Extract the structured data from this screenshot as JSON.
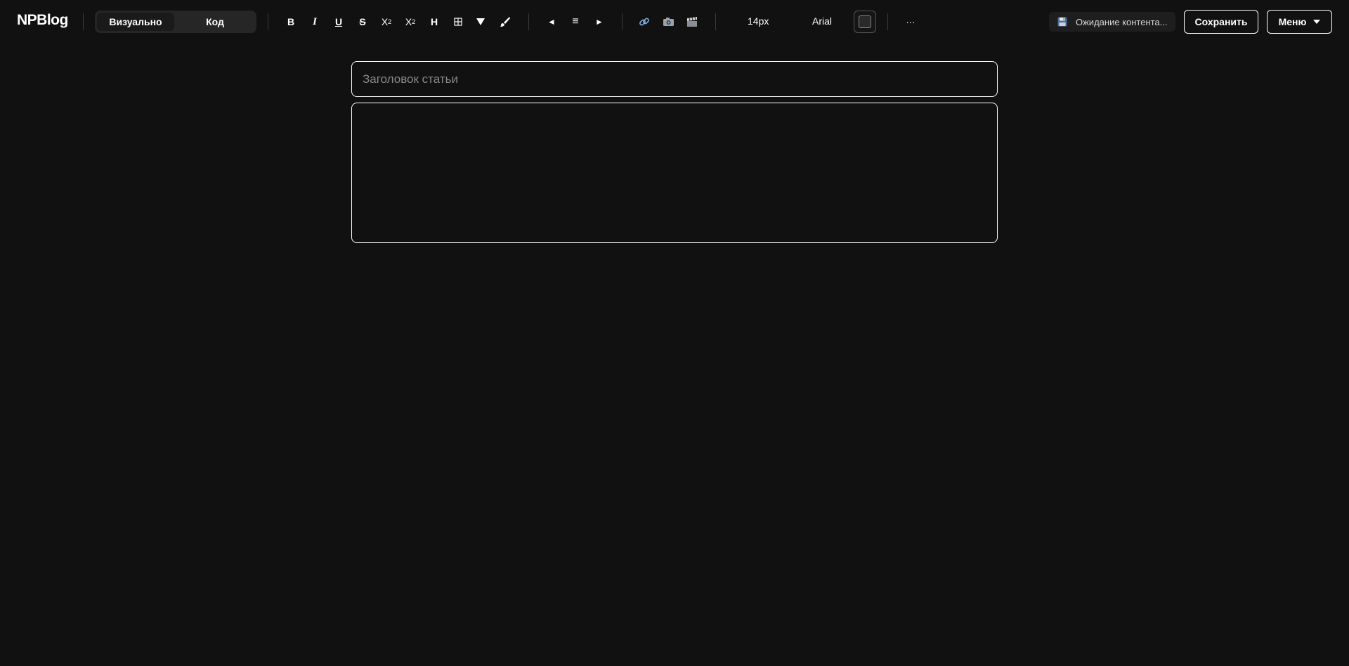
{
  "app": {
    "logo": "NPBlog"
  },
  "mode_switch": {
    "visual": "Визуально",
    "code": "Код"
  },
  "toolbar": {
    "bold": "B",
    "italic": "I",
    "underline": "U",
    "strike": "S",
    "superscript_base": "X",
    "superscript_exp": "2",
    "subscript_base": "X",
    "subscript_sub": "2",
    "heading": "H",
    "table_icon": "table-icon",
    "fill_icon": "fill-triangle-icon",
    "brush_icon": "brush-icon",
    "align_left": "◄",
    "align_center": "≡",
    "align_right": "►",
    "link_icon": "link-icon",
    "image_icon": "camera-icon",
    "video_icon": "clapper-icon",
    "font_size": "14px",
    "font_family": "Arial",
    "text_color": "#2a2a2a",
    "more": "···"
  },
  "status": {
    "icon": "floppy-disk-icon",
    "text": "Ожидание контента..."
  },
  "actions": {
    "save": "Сохранить",
    "menu": "Меню"
  },
  "editor": {
    "title_placeholder": "Заголовок статьи",
    "title_value": ""
  },
  "colors": {
    "background": "#111111",
    "foreground": "#ffffff",
    "border": "#ffffff"
  }
}
